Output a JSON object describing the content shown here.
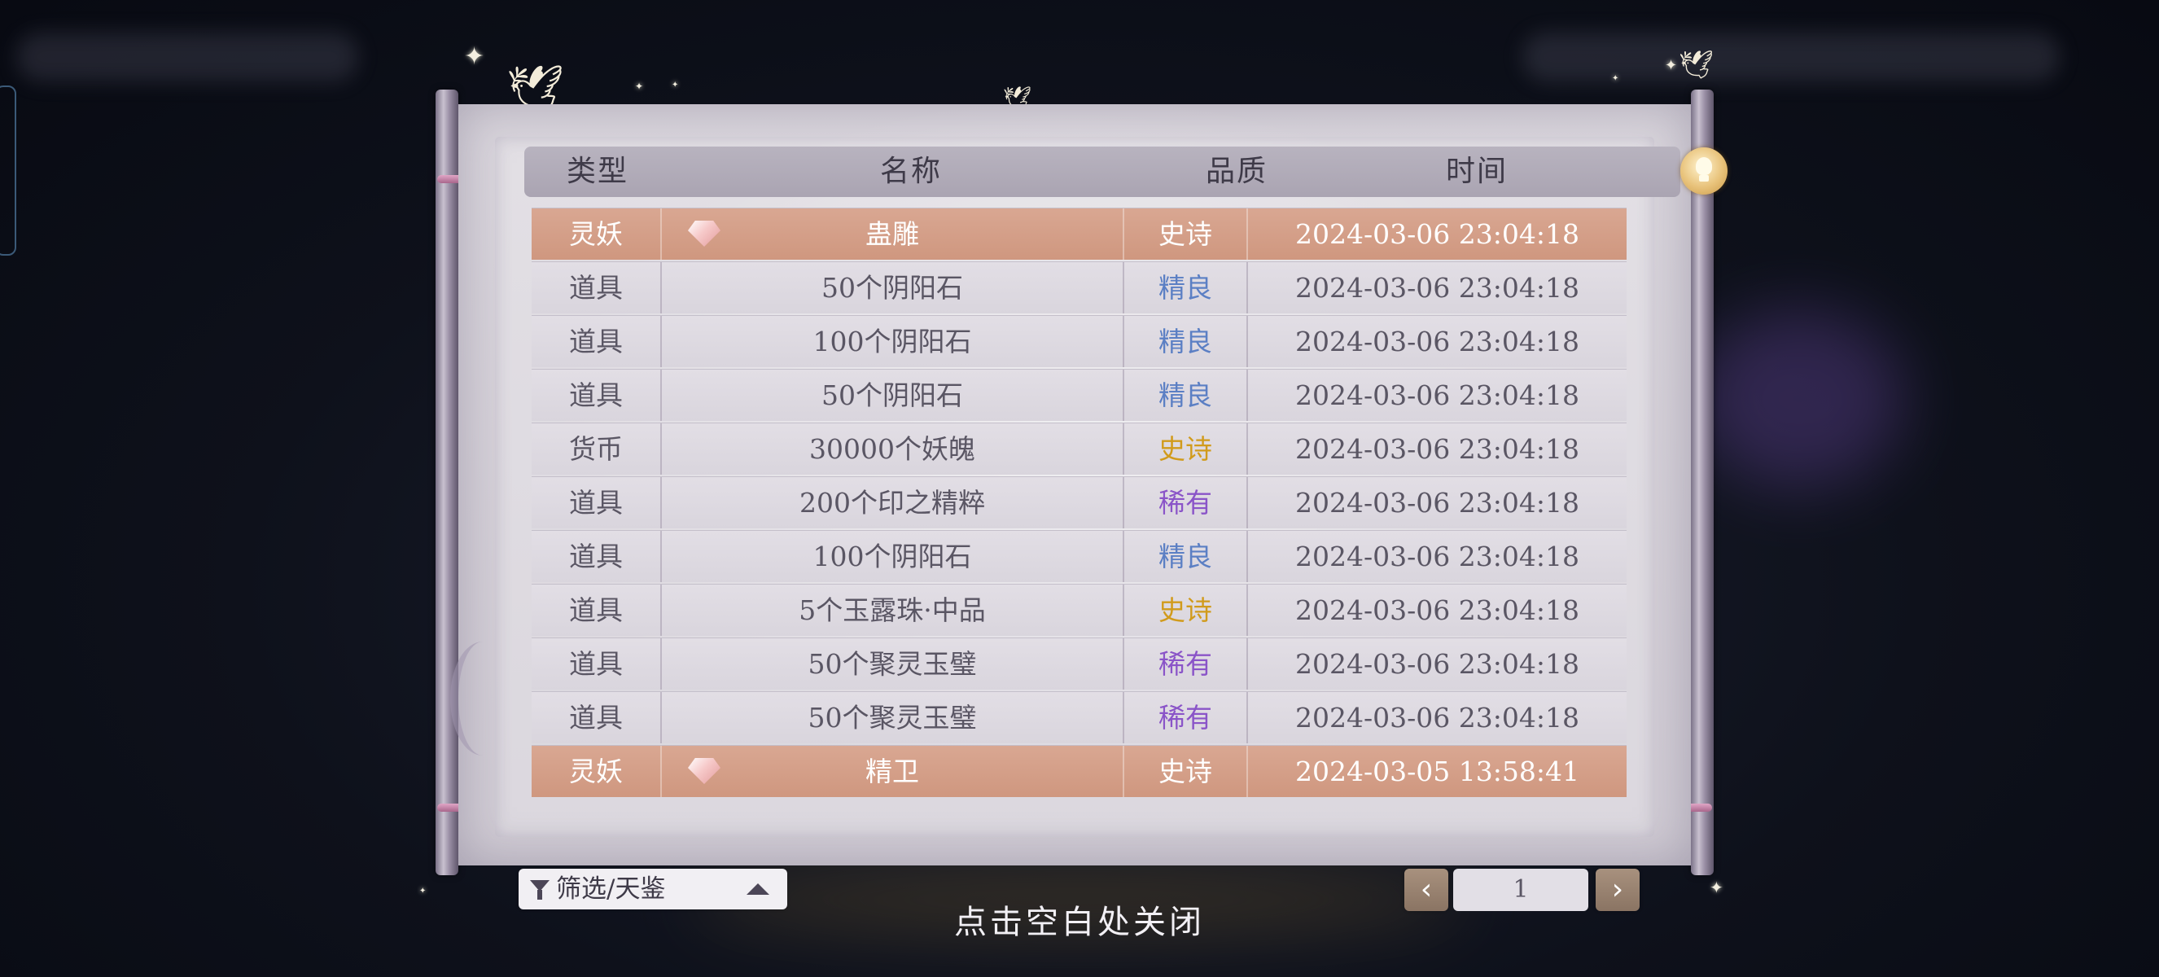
{
  "table": {
    "headers": {
      "type": "类型",
      "name": "名称",
      "quality": "品质",
      "time": "时间"
    },
    "rows": [
      {
        "type": "灵妖",
        "name": "蛊雕",
        "quality": "史诗",
        "time": "2024-03-06  23:04:18",
        "highlight": true,
        "icon": "gem-icon",
        "quality_color": "#ffffff"
      },
      {
        "type": "道具",
        "name": "50个阴阳石",
        "quality": "精良",
        "time": "2024-03-06  23:04:18",
        "highlight": false,
        "quality_color": "#5b7fc4"
      },
      {
        "type": "道具",
        "name": "100个阴阳石",
        "quality": "精良",
        "time": "2024-03-06  23:04:18",
        "highlight": false,
        "quality_color": "#5b7fc4"
      },
      {
        "type": "道具",
        "name": "50个阴阳石",
        "quality": "精良",
        "time": "2024-03-06  23:04:18",
        "highlight": false,
        "quality_color": "#5b7fc4"
      },
      {
        "type": "货币",
        "name": "30000个妖魄",
        "quality": "史诗",
        "time": "2024-03-06  23:04:18",
        "highlight": false,
        "quality_color": "#d19b1c"
      },
      {
        "type": "道具",
        "name": "200个印之精粹",
        "quality": "稀有",
        "time": "2024-03-06  23:04:18",
        "highlight": false,
        "quality_color": "#8a54c8"
      },
      {
        "type": "道具",
        "name": "100个阴阳石",
        "quality": "精良",
        "time": "2024-03-06  23:04:18",
        "highlight": false,
        "quality_color": "#5b7fc4"
      },
      {
        "type": "道具",
        "name": "5个玉露珠·中品",
        "quality": "史诗",
        "time": "2024-03-06  23:04:18",
        "highlight": false,
        "quality_color": "#d19b1c"
      },
      {
        "type": "道具",
        "name": "50个聚灵玉璧",
        "quality": "稀有",
        "time": "2024-03-06  23:04:18",
        "highlight": false,
        "quality_color": "#8a54c8"
      },
      {
        "type": "道具",
        "name": "50个聚灵玉璧",
        "quality": "稀有",
        "time": "2024-03-06  23:04:18",
        "highlight": false,
        "quality_color": "#8a54c8"
      },
      {
        "type": "灵妖",
        "name": "精卫",
        "quality": "史诗",
        "time": "2024-03-05  13:58:41",
        "highlight": true,
        "icon": "gem-icon",
        "quality_color": "#ffffff"
      }
    ]
  },
  "footer": {
    "filter_label": "筛选/天鉴",
    "filter_icon": "funnel-icon",
    "filter_toggle_icon": "triangle-up-icon",
    "prev_icon": "chevron-left-icon",
    "prev_glyph": "‹",
    "next_icon": "chevron-right-icon",
    "next_glyph": "›",
    "page": "1"
  },
  "close_hint": "点击空白处关闭",
  "colors": {
    "highlight_row": "#d4a08a",
    "fine": "#5b7fc4",
    "rare": "#8a54c8",
    "epic": "#d19b1c"
  }
}
